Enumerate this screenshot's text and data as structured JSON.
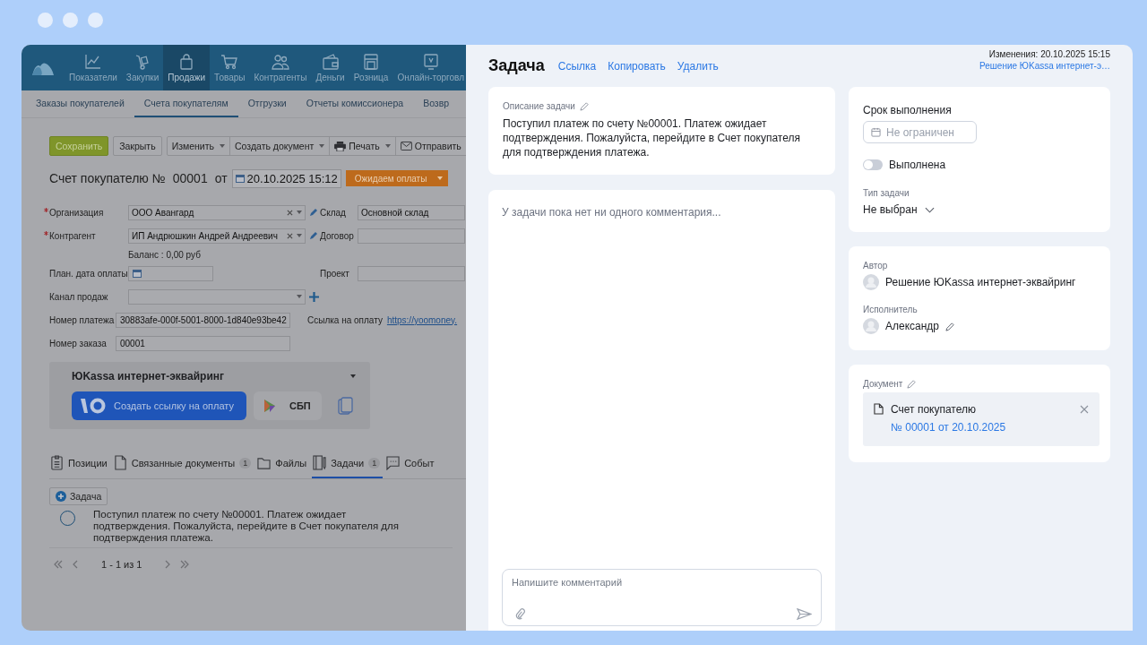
{
  "app": {
    "nav": [
      {
        "label": "Показатели",
        "selected": false
      },
      {
        "label": "Закупки",
        "selected": false
      },
      {
        "label": "Продажи",
        "selected": true
      },
      {
        "label": "Товары",
        "selected": false
      },
      {
        "label": "Контрагенты",
        "selected": false
      },
      {
        "label": "Деньги",
        "selected": false
      },
      {
        "label": "Розница",
        "selected": false
      },
      {
        "label": "Онлайн-торговл",
        "selected": false
      }
    ],
    "subnav": [
      {
        "label": "Заказы покупателей",
        "selected": false
      },
      {
        "label": "Счета покупателям",
        "selected": true
      },
      {
        "label": "Отгрузки",
        "selected": false
      },
      {
        "label": "Отчеты комиссионера",
        "selected": false
      },
      {
        "label": "Возвр",
        "selected": false
      }
    ],
    "toolbar": {
      "save": "Сохранить",
      "close": "Закрыть",
      "menus": [
        {
          "label": "Изменить",
          "kind": "plain"
        },
        {
          "label": "Создать документ",
          "kind": "plain"
        },
        {
          "label": "Печать",
          "kind": "print"
        },
        {
          "label": "Отправить",
          "kind": "send"
        }
      ]
    },
    "document": {
      "title": "Счет покупателю №",
      "number": "00001",
      "from": "от",
      "date": "20.10.2025 15:12",
      "status": "Ожидаем оплаты"
    },
    "form": [
      {
        "left": {
          "kind": "select",
          "label": "Организация",
          "required": true,
          "value": "ООО Авангард"
        },
        "right": {
          "kind": "text",
          "label": "Склад",
          "value": "Основной склад"
        }
      },
      {
        "left": {
          "kind": "select",
          "label": "Контрагент",
          "required": true,
          "value": "ИП Андрюшкин Андрей Андреевич"
        },
        "right": {
          "kind": "text",
          "label": "Договор"
        }
      },
      {
        "left": {
          "kind": "note",
          "value": "Баланс : 0,00 руб"
        }
      },
      {
        "left": {
          "kind": "date",
          "label": "План. дата оплаты",
          "required": false
        },
        "right": {
          "kind": "text",
          "label": "Проект"
        }
      },
      {
        "left": {
          "kind": "combo",
          "label": "Канал продаж",
          "required": false
        }
      },
      {
        "left": {
          "kind": "text",
          "label": "Номер платежа",
          "required": false,
          "value": "30883afe-000f-5001-8000-1d840e93be42"
        },
        "right": {
          "kind": "link",
          "label": "Ссылка на оплату",
          "value": "https://yoomoney."
        }
      },
      {
        "left": {
          "kind": "text",
          "label": "Номер заказа",
          "required": false,
          "value": "00001"
        }
      }
    ],
    "yookassa": {
      "title": "ЮKassa интернет-эквайринг",
      "pay_button": "Создать ссылку на оплату",
      "sbp_button": "СБП"
    },
    "tabs": [
      {
        "label": "Позиции",
        "selected": false
      },
      {
        "label": "Связанные документы",
        "count": "1",
        "selected": false
      },
      {
        "label": "Файлы",
        "selected": false
      },
      {
        "label": "Задачи",
        "count": "1",
        "selected": true
      },
      {
        "label": "Событ",
        "selected": false
      }
    ],
    "add_task": "Задача",
    "tasks": [
      {
        "text": "Поступил платеж по счету №00001. Платеж ожидает подтверждения. Пожалуйста, перейдите в Счет покупателя для подтверждения платежа.",
        "done": false
      }
    ],
    "pagination": "1 - 1 из 1"
  },
  "task": {
    "title": "Задача",
    "actions": [
      "Ссылка",
      "Копировать",
      "Удалить"
    ],
    "changed": "Изменения: 20.10.2025 15:15",
    "changed_by": "Решение ЮKassa интернет-э…",
    "description_label": "Описание задачи",
    "description": "Поступил платеж по счету №00001. Платеж ожидает подтверждения. Пожалуйста, перейдите в Счет покупателя для подтверждения платежа.",
    "comments_empty": "У задачи пока нет ни одного комментария...",
    "comment_placeholder": "Напишите комментарий",
    "deadline_label": "Срок выполнения",
    "deadline_placeholder": "Не ограничен",
    "done_label": "Выполнена",
    "done": false,
    "type_label": "Тип задачи",
    "type_value": "Не выбран",
    "author_label": "Автор",
    "author": "Решение ЮKassa интернет-эквайринг",
    "assignee_label": "Исполнитель",
    "assignee": "Александр",
    "document_label": "Документ",
    "document_title": "Счет покупателю",
    "document_link": "№ 00001 от 20.10.2025"
  }
}
